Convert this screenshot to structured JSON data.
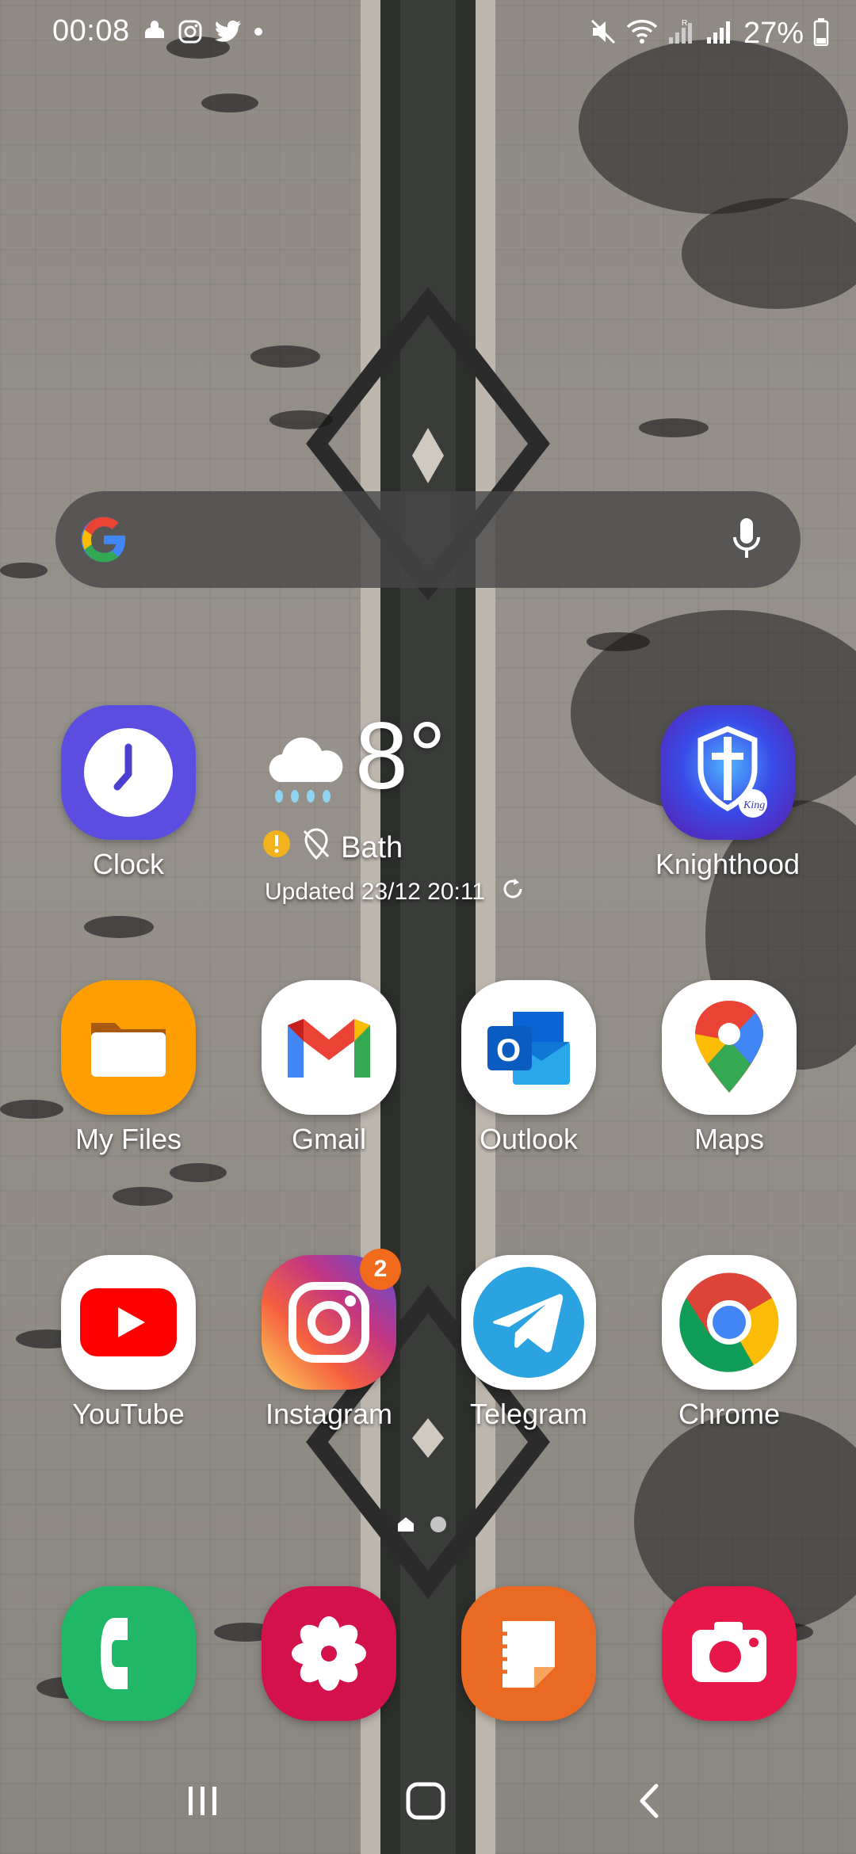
{
  "status_bar": {
    "time": "00:08",
    "battery": "27%"
  },
  "search": {
    "placeholder": ""
  },
  "weather": {
    "temperature": "8°",
    "location": "Bath",
    "updated": "Updated 23/12 20:11"
  },
  "apps": {
    "clock": "Clock",
    "knighthood": "Knighthood",
    "my_files": "My Files",
    "gmail": "Gmail",
    "outlook": "Outlook",
    "maps": "Maps",
    "youtube": "YouTube",
    "instagram": "Instagram",
    "instagram_badge": "2",
    "telegram": "Telegram",
    "chrome": "Chrome"
  },
  "dock": [
    "phone-icon",
    "blossom-gallery-icon",
    "notes-icon",
    "camera-icon"
  ],
  "colors": {
    "clock_bg": "#5b4de0",
    "files_bg": "#ff9e00",
    "phone_bg": "#20b866",
    "gallery_bg": "#d3124c",
    "notes_bg": "#ea6a23",
    "camera_bg": "#e8174a",
    "badge": "#f26a1b"
  }
}
